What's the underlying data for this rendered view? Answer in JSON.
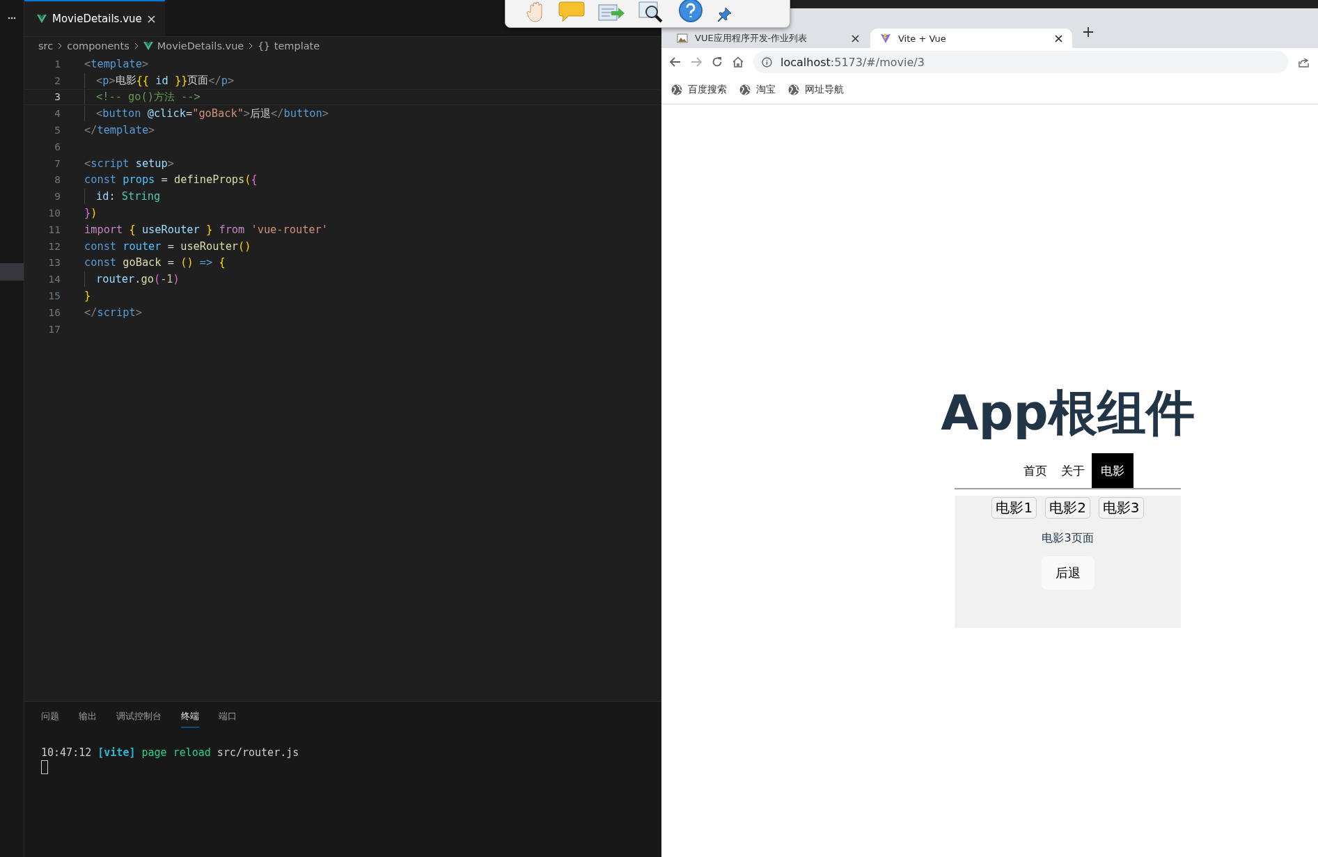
{
  "editor": {
    "tab": {
      "title": "MovieDetails.vue",
      "selected": true
    },
    "breadcrumb": [
      {
        "label": "src"
      },
      {
        "label": "components"
      },
      {
        "label": "MovieDetails.vue",
        "kind": "vue"
      },
      {
        "label": "template",
        "symbol": "{}"
      }
    ],
    "lines": [
      {
        "number": "1",
        "current": false,
        "guide": false,
        "tokens": [
          {
            "kind": "punct",
            "t": "<"
          },
          {
            "kind": "tag",
            "t": "template"
          },
          {
            "kind": "punct",
            "t": ">"
          }
        ]
      },
      {
        "number": "2",
        "current": false,
        "guide": true,
        "tokens": [
          {
            "kind": "punct",
            "t": "<"
          },
          {
            "kind": "tag",
            "t": "p"
          },
          {
            "kind": "punct",
            "t": ">"
          },
          {
            "kind": "text",
            "t": "电影"
          },
          {
            "kind": "brace1",
            "t": "{{"
          },
          {
            "kind": "var",
            "t": " id "
          },
          {
            "kind": "brace1",
            "t": "}}"
          },
          {
            "kind": "text",
            "t": "页面"
          },
          {
            "kind": "punct",
            "t": "</"
          },
          {
            "kind": "tag",
            "t": "p"
          },
          {
            "kind": "punct",
            "t": ">"
          }
        ]
      },
      {
        "number": "3",
        "current": true,
        "guide": true,
        "tokens": [
          {
            "kind": "comment",
            "t": "<!-- go()方法 -->"
          }
        ]
      },
      {
        "number": "4",
        "current": false,
        "guide": true,
        "tokens": [
          {
            "kind": "punct",
            "t": "<"
          },
          {
            "kind": "tag",
            "t": "button"
          },
          {
            "kind": "attr",
            "t": " @click"
          },
          {
            "kind": "text",
            "t": "="
          },
          {
            "kind": "string",
            "t": "\"goBack\""
          },
          {
            "kind": "punct",
            "t": ">"
          },
          {
            "kind": "text",
            "t": "后退"
          },
          {
            "kind": "punct",
            "t": "</"
          },
          {
            "kind": "tag",
            "t": "button"
          },
          {
            "kind": "punct",
            "t": ">"
          }
        ]
      },
      {
        "number": "5",
        "current": false,
        "guide": false,
        "tokens": [
          {
            "kind": "punct",
            "t": "</"
          },
          {
            "kind": "tag",
            "t": "template"
          },
          {
            "kind": "punct",
            "t": ">"
          }
        ]
      },
      {
        "number": "6",
        "current": false,
        "guide": false
      },
      {
        "number": "7",
        "current": false,
        "guide": false,
        "tokens": [
          {
            "kind": "punct",
            "t": "<"
          },
          {
            "kind": "tag",
            "t": "script"
          },
          {
            "kind": "attr",
            "t": " setup"
          },
          {
            "kind": "punct",
            "t": ">"
          }
        ]
      },
      {
        "number": "8",
        "current": false,
        "guide": false,
        "tokens": [
          {
            "kind": "keyword",
            "t": "const"
          },
          {
            "kind": "const",
            "t": " props"
          },
          {
            "kind": "text",
            "t": " = "
          },
          {
            "kind": "func",
            "t": "defineProps"
          },
          {
            "kind": "brace1",
            "t": "("
          },
          {
            "kind": "brace2",
            "t": "{"
          }
        ]
      },
      {
        "number": "9",
        "current": false,
        "guide": true,
        "tokens": [
          {
            "kind": "var",
            "t": "id"
          },
          {
            "kind": "text",
            "t": ": "
          },
          {
            "kind": "type",
            "t": "String"
          }
        ]
      },
      {
        "number": "10",
        "current": false,
        "guide": false,
        "tokens": [
          {
            "kind": "brace2",
            "t": "}"
          },
          {
            "kind": "brace1",
            "t": ")"
          }
        ]
      },
      {
        "number": "11",
        "current": false,
        "guide": false,
        "tokens": [
          {
            "kind": "control",
            "t": "import"
          },
          {
            "kind": "brace1",
            "t": " {"
          },
          {
            "kind": "var",
            "t": " useRouter "
          },
          {
            "kind": "brace1",
            "t": "}"
          },
          {
            "kind": "control",
            "t": " from "
          },
          {
            "kind": "string",
            "t": "'vue-router'"
          }
        ]
      },
      {
        "number": "12",
        "current": false,
        "guide": false,
        "tokens": [
          {
            "kind": "keyword",
            "t": "const"
          },
          {
            "kind": "const",
            "t": " router"
          },
          {
            "kind": "text",
            "t": " = "
          },
          {
            "kind": "func",
            "t": "useRouter"
          },
          {
            "kind": "brace1",
            "t": "()"
          }
        ]
      },
      {
        "number": "13",
        "current": false,
        "guide": false,
        "tokens": [
          {
            "kind": "keyword",
            "t": "const"
          },
          {
            "kind": "func",
            "t": " goBack"
          },
          {
            "kind": "text",
            "t": " = "
          },
          {
            "kind": "brace1",
            "t": "()"
          },
          {
            "kind": "keyword",
            "t": " => "
          },
          {
            "kind": "brace1",
            "t": "{"
          }
        ]
      },
      {
        "number": "14",
        "current": false,
        "guide": true,
        "tokens": [
          {
            "kind": "var",
            "t": "router"
          },
          {
            "kind": "text",
            "t": "."
          },
          {
            "kind": "func",
            "t": "go"
          },
          {
            "kind": "brace2",
            "t": "("
          },
          {
            "kind": "number",
            "t": "-1"
          },
          {
            "kind": "brace2",
            "t": ")"
          }
        ]
      },
      {
        "number": "15",
        "current": false,
        "guide": false,
        "tokens": [
          {
            "kind": "brace1",
            "t": "}"
          }
        ]
      },
      {
        "number": "16",
        "current": false,
        "guide": false,
        "tokens": [
          {
            "kind": "punct",
            "t": "</"
          },
          {
            "kind": "tag",
            "t": "script"
          },
          {
            "kind": "punct",
            "t": ">"
          }
        ]
      },
      {
        "number": "17",
        "current": false,
        "guide": false
      }
    ]
  },
  "panel": {
    "tabs": [
      {
        "label": "问题",
        "selected": false
      },
      {
        "label": "输出",
        "selected": false
      },
      {
        "label": "调试控制台",
        "selected": false
      },
      {
        "label": "终端",
        "selected": true
      },
      {
        "label": "端口",
        "selected": false
      }
    ],
    "terminal": [
      {
        "kind": "text",
        "t": "10:47:12 "
      },
      {
        "kind": "tag",
        "t": "[vite]"
      },
      {
        "kind": "green",
        "t": " page reload"
      },
      {
        "kind": "text",
        "t": " src/router.js"
      }
    ]
  },
  "browser": {
    "tabs": [
      {
        "title": "VUE应用程序开发-作业列表",
        "selected": false
      },
      {
        "title": "Vite + Vue",
        "selected": true
      }
    ],
    "url_host": "localhost",
    "url_rest": ":5173/#/movie/3",
    "bookmarks": [
      "百度搜索",
      "淘宝",
      "网址导航"
    ]
  },
  "app": {
    "title": "App根组件",
    "nav": [
      {
        "label": "首页",
        "selected": false
      },
      {
        "label": "关于",
        "selected": false
      },
      {
        "label": "电影",
        "selected": true
      }
    ],
    "movies": [
      "电影1",
      "电影2",
      "电影3"
    ],
    "page_text": "电影3页面",
    "back_button": "后退"
  }
}
